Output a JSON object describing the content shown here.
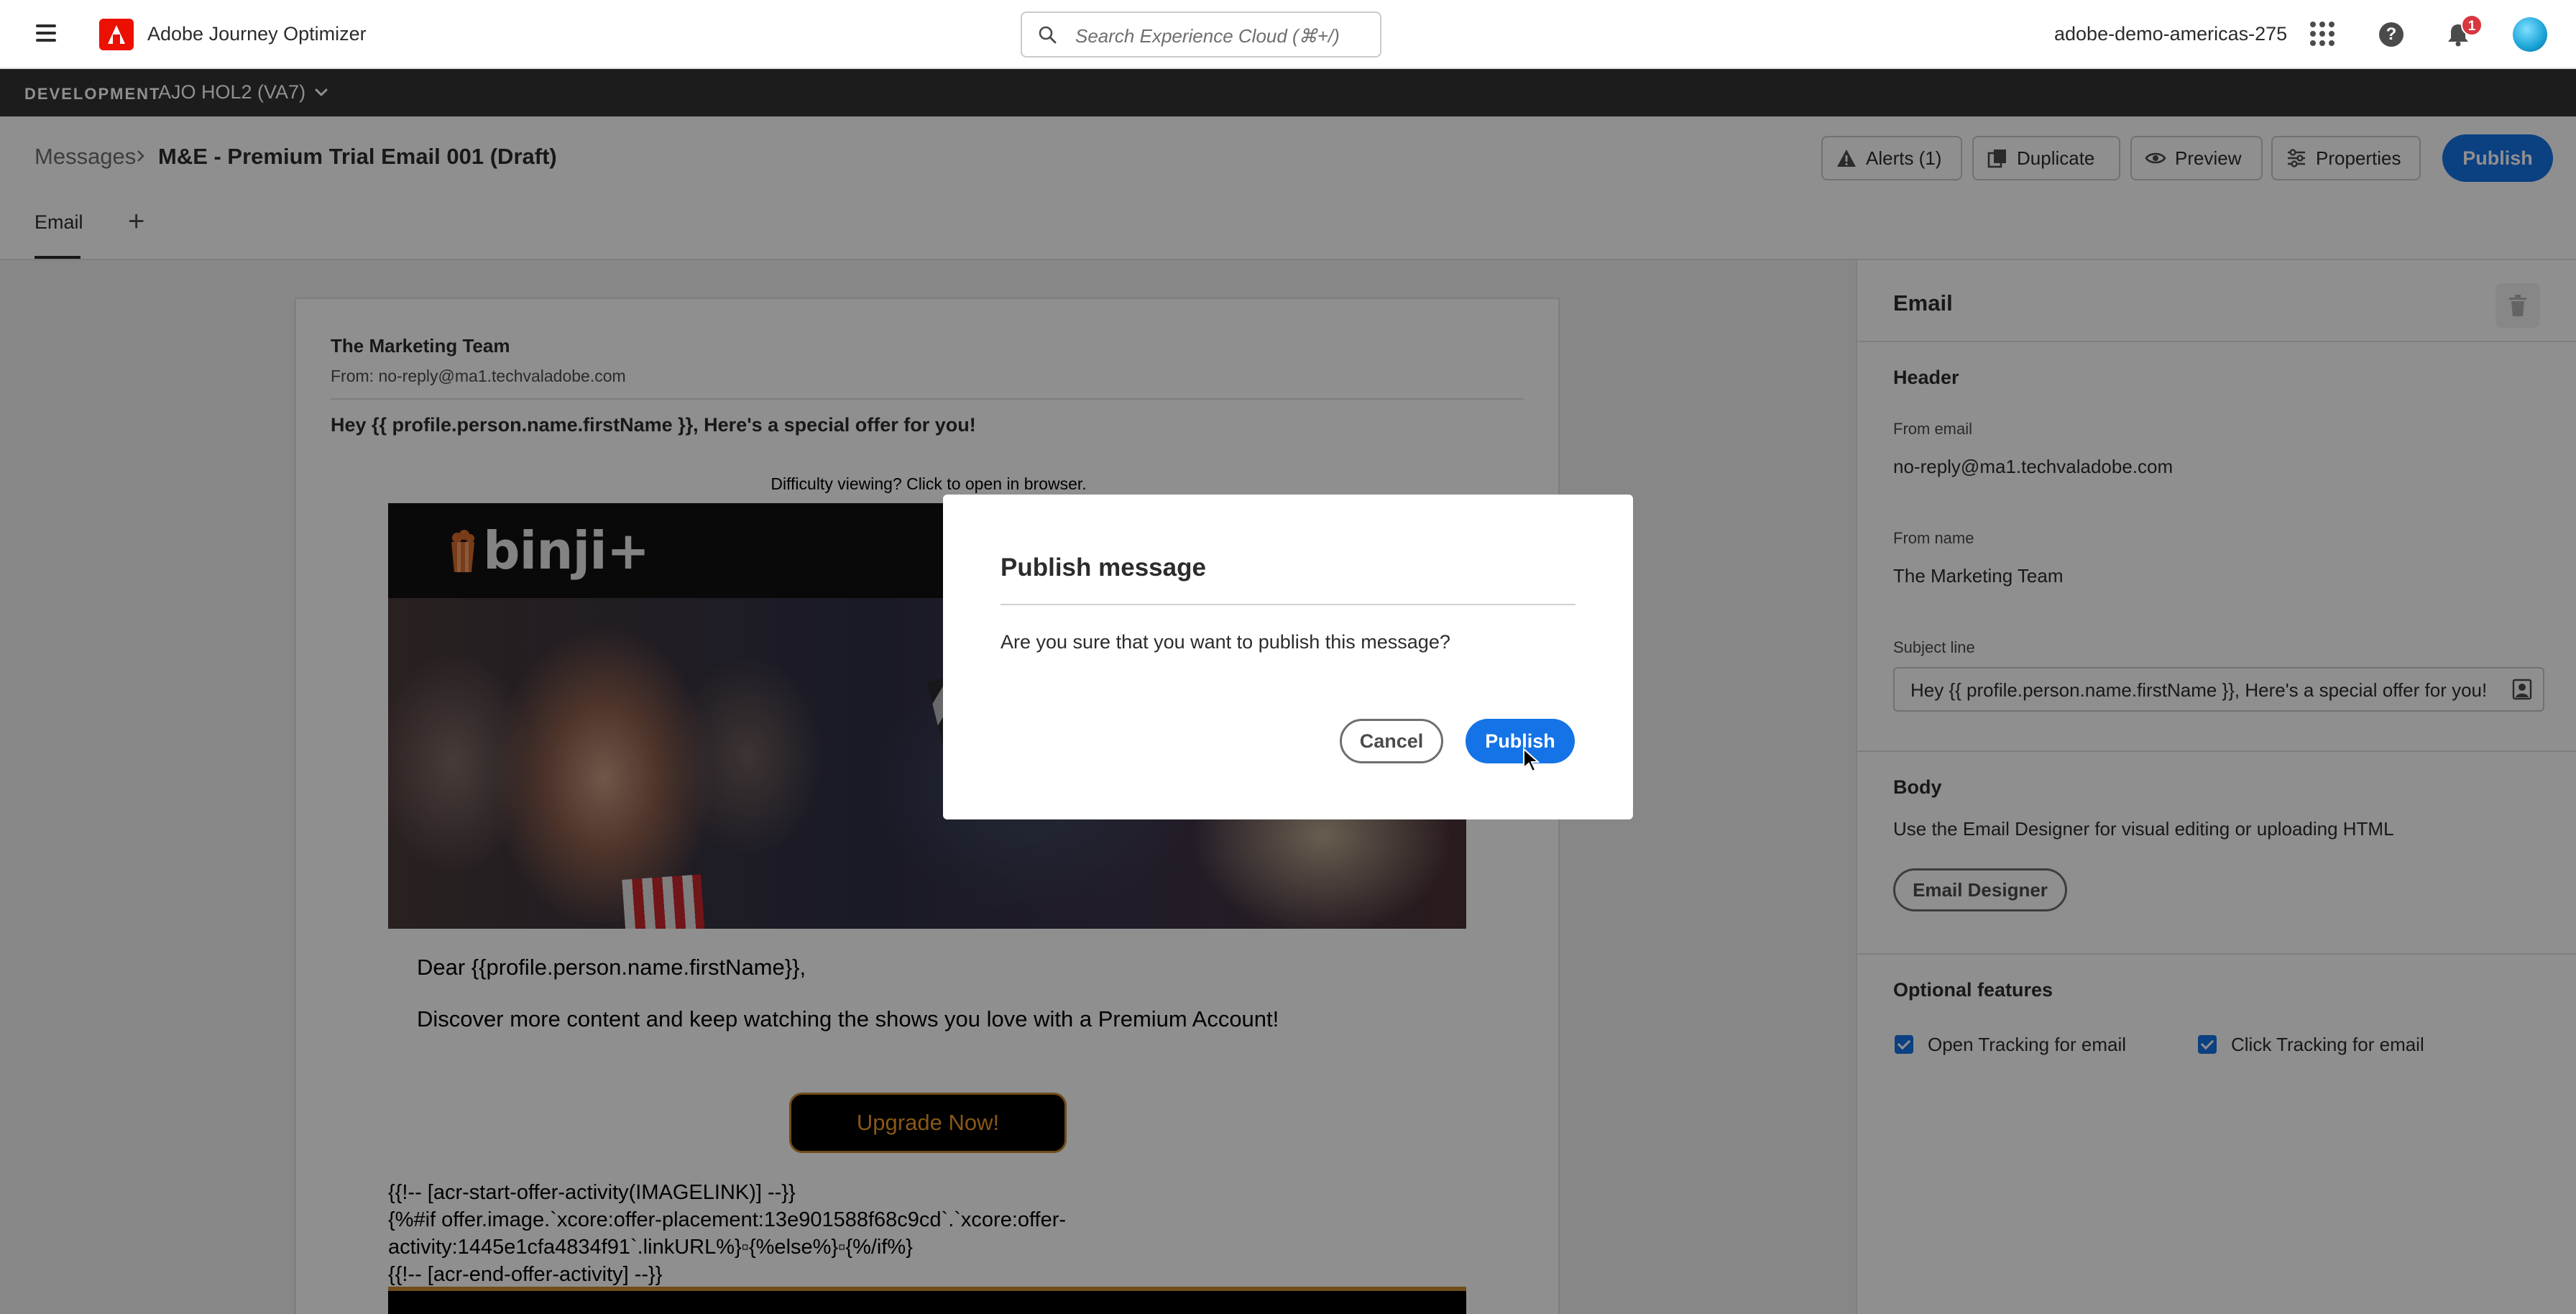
{
  "shell": {
    "app_name": "Adobe Journey Optimizer",
    "search_placeholder": "Search Experience Cloud (⌘+/)",
    "org_name": "adobe-demo-americas-275",
    "notification_count": "1"
  },
  "env": {
    "label": "DEVELOPMENT",
    "sandbox": "AJO HOL2 (VA7)"
  },
  "breadcrumb": {
    "parent": "Messages",
    "current": "M&E - Premium Trial Email 001 (Draft)"
  },
  "toolbar": {
    "alerts": "Alerts (1)",
    "duplicate": "Duplicate",
    "preview": "Preview",
    "properties": "Properties",
    "publish": "Publish"
  },
  "tabs": {
    "email": "Email",
    "add": "+"
  },
  "email_preview": {
    "from_name": "The Marketing Team",
    "from": "From: no-reply@ma1.techvaladobe.com",
    "subject": "Hey {{ profile.person.name.firstName }}, Here's a special offer for you!",
    "view_in_browser": "Difficulty viewing? Click to open in browser.",
    "brand": "binji+",
    "greeting": "Dear {{profile.person.name.firstName}},",
    "body": "Discover more content and keep watching the shows you love with a Premium Account!",
    "cta": "Upgrade Now!",
    "code_lines": [
      "{{!-- [acr-start-offer-activity(IMAGELINK)] --}}",
      "{%#if offer.image.`xcore:offer-placement:13e901588f68c9cd`.`xcore:offer-",
      "activity:1445e1cfa4834f91`.linkURL%}▫{%else%}▫{%/if%}",
      "{{!-- [acr-end-offer-activity] --}}"
    ]
  },
  "panel": {
    "title": "Email",
    "header_section": "Header",
    "from_email_label": "From email",
    "from_email_value": "no-reply@ma1.techvaladobe.com",
    "from_name_label": "From name",
    "from_name_value": "The Marketing Team",
    "subject_label": "Subject line",
    "subject_value": "Hey {{ profile.person.name.firstName }}, Here's a special offer for you!",
    "body_section": "Body",
    "body_desc": "Use the Email Designer for visual editing or uploading HTML",
    "designer_button": "Email Designer",
    "optional_section": "Optional features",
    "open_tracking": "Open Tracking for email",
    "click_tracking": "Click Tracking for email"
  },
  "modal": {
    "title": "Publish message",
    "body": "Are you sure that you want to publish this message?",
    "cancel": "Cancel",
    "publish": "Publish"
  },
  "colors": {
    "accent": "#1473e6",
    "adobe_red": "#eb1000",
    "env_bar": "#323232",
    "cta_orange": "#f29b2b"
  }
}
